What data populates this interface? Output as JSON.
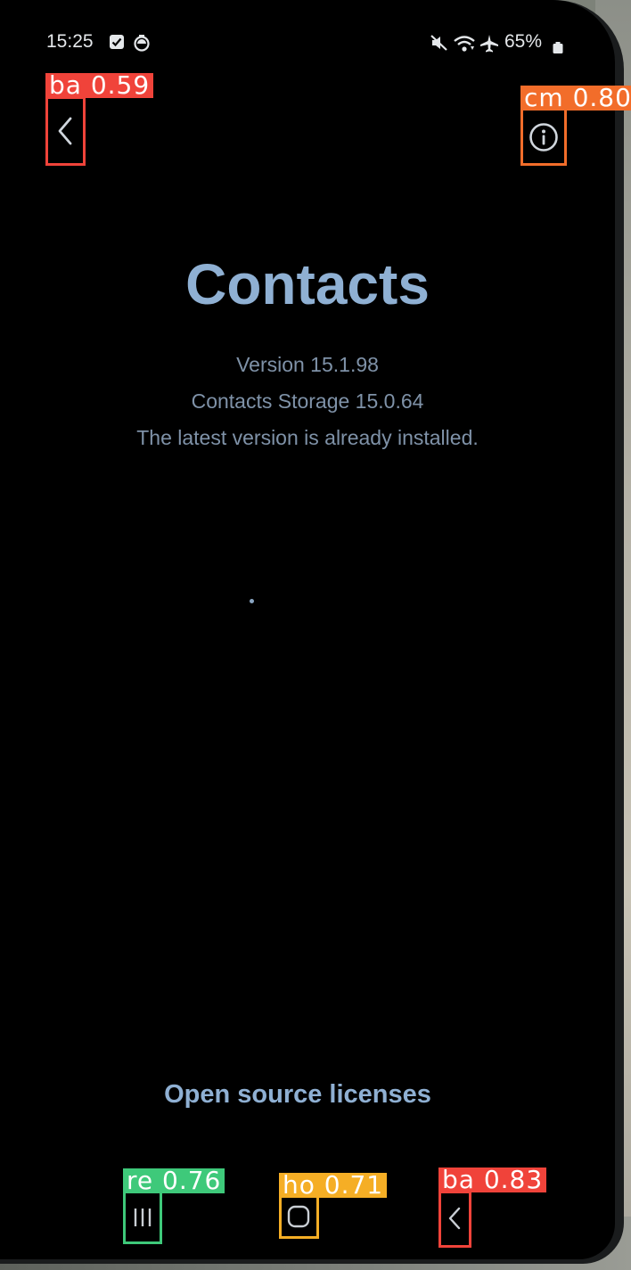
{
  "status_bar": {
    "time": "15:25",
    "battery": "65%",
    "icons": [
      "checkbox-notification-icon",
      "timer-notification-icon",
      "mute-icon",
      "wifi-icon",
      "airplane-icon",
      "battery-icon"
    ]
  },
  "toolbar": {
    "back_icon": "chevron-left-icon",
    "info_icon": "info-circle-icon"
  },
  "app": {
    "title": "Contacts",
    "version": "Version 15.1.98",
    "storage_version": "Contacts Storage 15.0.64",
    "update_status": "The latest version is already installed."
  },
  "footer": {
    "open_source_link": "Open source licenses"
  },
  "nav_bar": {
    "recents_icon": "recents-icon",
    "home_icon": "home-icon",
    "back_icon": "back-icon"
  },
  "detections": [
    {
      "label": "ba 0.59",
      "color": "#f0433a"
    },
    {
      "label": "cm 0.80",
      "color": "#f26d2a"
    },
    {
      "label": "re 0.76",
      "color": "#3ec97a"
    },
    {
      "label": "ho 0.71",
      "color": "#f5ae25"
    },
    {
      "label": "ba 0.83",
      "color": "#f0433a"
    }
  ],
  "colors": {
    "accent_blue": "#8fb0d3",
    "secondary_text": "#7f92a8",
    "screen_bg": "#000000"
  }
}
